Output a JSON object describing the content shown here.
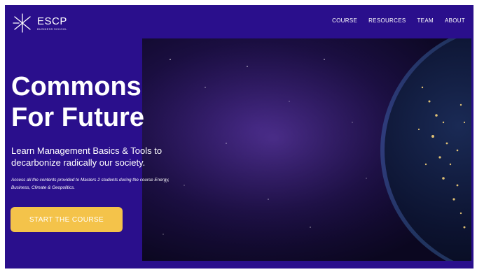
{
  "brand": {
    "name": "ESCP",
    "subtitle": "BUSINESS SCHOOL"
  },
  "nav": {
    "items": [
      {
        "label": "COURSE"
      },
      {
        "label": "RESOURCES"
      },
      {
        "label": "TEAM"
      },
      {
        "label": "ABOUT"
      }
    ]
  },
  "hero": {
    "title_line1": "Commons",
    "title_line2": "For Future",
    "subtitle": "Learn Management Basics & Tools to decarbonize radically our society.",
    "description": "Access all the contents provided to Masters 2 students during the course Energy, Business, Climate & Geopolitics.",
    "cta_label": "START THE COURSE"
  },
  "colors": {
    "background": "#2a0f8c",
    "cta": "#f4c34a",
    "text": "#ffffff"
  },
  "icons": {
    "logo": "escp-star-icon",
    "hero_image": "earth-from-space-image"
  }
}
